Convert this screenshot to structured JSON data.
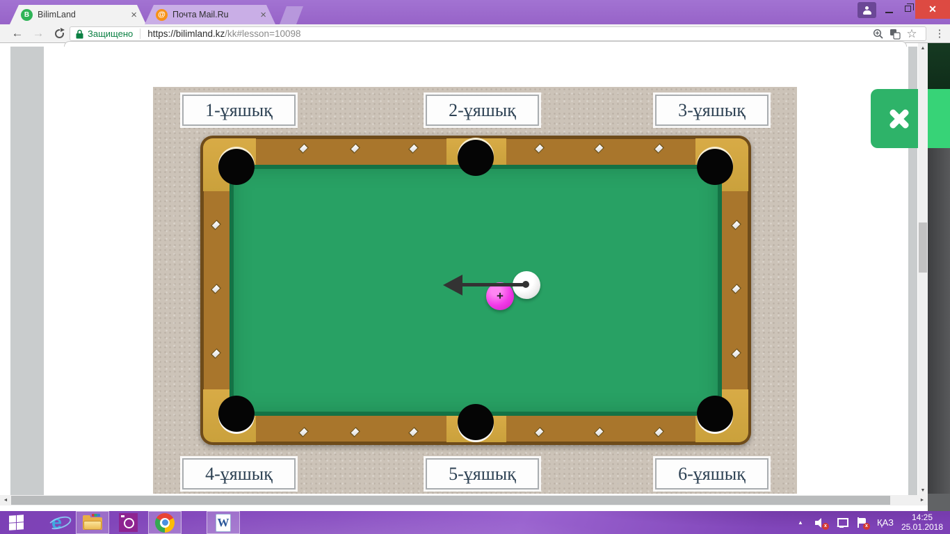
{
  "browser": {
    "tabs": [
      {
        "title": "BilimLand",
        "favicon_letter": "B"
      },
      {
        "title": "Почта Mail.Ru",
        "favicon_letter": "@"
      }
    ],
    "toolbar": {
      "security_label": "Защищено",
      "url_domain": "https://bilimland.kz",
      "url_path": "/kk#lesson=10098"
    }
  },
  "icons": {
    "tab_close": "×",
    "window_close": "✕",
    "back": "←",
    "forward": "→",
    "star": "☆",
    "menu": "⋮",
    "plus": "+",
    "tray_expand": "▲",
    "scroll_up": "▲",
    "scroll_down": "▼",
    "scroll_left": "◄",
    "scroll_right": "►",
    "mute_x": "x",
    "alert_x": "x"
  },
  "game": {
    "pocket_labels": [
      "1-ұяшық",
      "2-ұяшық",
      "3-ұяшық",
      "4-ұяшық",
      "5-ұяшық",
      "6-ұяшық"
    ]
  },
  "taskbar": {
    "language": "ҚАЗ",
    "time": "14:25",
    "date": "25.01.2018"
  },
  "colors": {
    "accent_purple": "#8a50c2",
    "felt_green": "#28a164",
    "rail_brown": "#a9762c",
    "gold": "#d0a33f",
    "button_green": "#2eb369",
    "secure_green": "#0b8043",
    "close_red": "#dd4a42",
    "pink_ball": "#f23ae8"
  }
}
